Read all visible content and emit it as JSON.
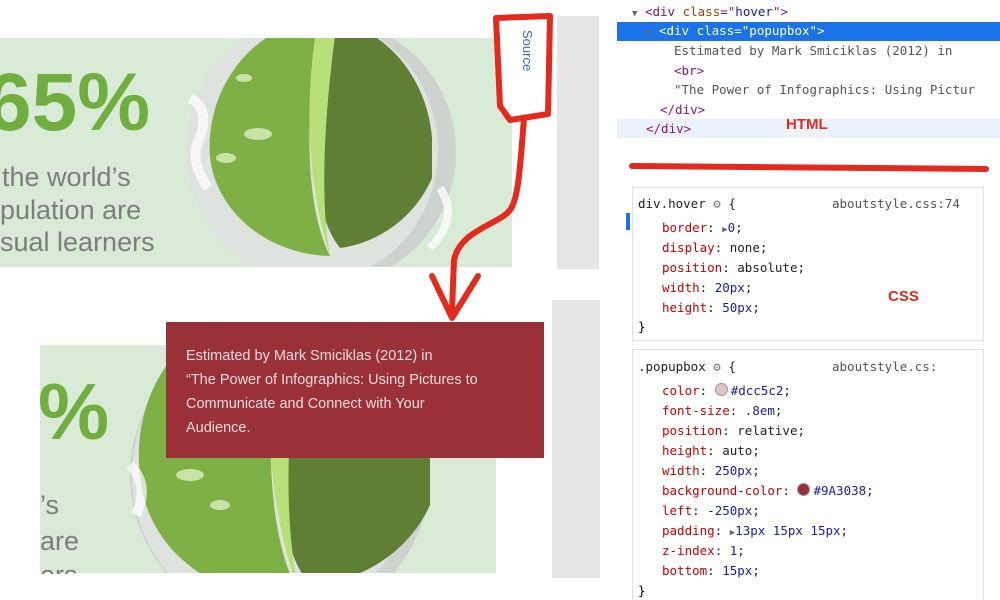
{
  "infographic": {
    "top_percent": "65%",
    "top_caption_lines": [
      "the world’s",
      "pulation are",
      "sual learners"
    ],
    "bottom_percent": "%",
    "bottom_caption_lines": [
      "’s",
      "are",
      "ers"
    ],
    "source_label": "Source",
    "popup_lines": [
      "Estimated by Mark Smiciklas (2012) in",
      "“The Power of Infographics: Using Pictures to",
      "Communicate and Connect with Your",
      "Audience."
    ],
    "colors": {
      "panel": "#d9ead6",
      "globe_light": "#8bc34a",
      "globe_dark": "#5e7f34",
      "accent_red": "#e42a1d",
      "popup_bg": "#9a3038"
    }
  },
  "annotations": {
    "html_label": "HTML",
    "css_label": "CSS"
  },
  "devtools": {
    "tree": {
      "line1": {
        "open": "<div ",
        "attr": "class",
        "eq": "=\"",
        "val": "hover",
        "close": "\">"
      },
      "line2": {
        "open": "<div ",
        "attr": "class",
        "eq": "=\"",
        "val": "popupbox",
        "close": "\">"
      },
      "line3": "Estimated by Mark Smiciklas (2012) in",
      "line4": "<br>",
      "line5": "\"The Power of Infographics: Using Pictur",
      "line6": "</div>",
      "line7": "</div>"
    },
    "rule1": {
      "selector": "div.hover",
      "brace": "{",
      "file": "aboutstyle.css:74",
      "props": [
        {
          "name": "border",
          "value": "0",
          "expander": true
        },
        {
          "name": "display",
          "value": "none"
        },
        {
          "name": "position",
          "value": "absolute"
        },
        {
          "name": "width",
          "value": "20px"
        },
        {
          "name": "height",
          "value": "50px"
        }
      ],
      "close": "}"
    },
    "rule2": {
      "selector": ".popupbox",
      "brace": "{",
      "file": "aboutstyle.cs:",
      "props": [
        {
          "name": "color",
          "value": "#dcc5c2",
          "swatch": "#dcc5c2"
        },
        {
          "name": "font-size",
          "value": ".8em"
        },
        {
          "name": "position",
          "value": "relative"
        },
        {
          "name": "height",
          "value": "auto"
        },
        {
          "name": "width",
          "value": "250px"
        },
        {
          "name": "background-color",
          "value": "#9A3038",
          "swatch": "#9a3038"
        },
        {
          "name": "left",
          "value": "-250px"
        },
        {
          "name": "padding",
          "value": "13px 15px 15px",
          "expander": true
        },
        {
          "name": "z-index",
          "value": "1"
        },
        {
          "name": "bottom",
          "value": "15px"
        }
      ],
      "close": "}"
    }
  }
}
